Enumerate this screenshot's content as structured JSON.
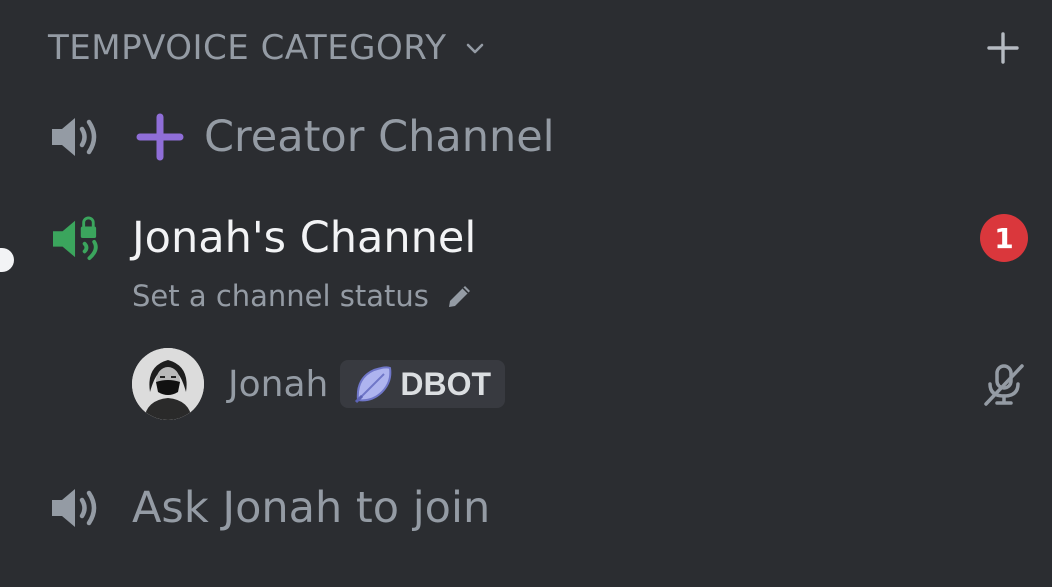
{
  "category": {
    "title": "TEMPVOICE CATEGORY",
    "chevron_icon": "chevron-down-icon",
    "add_icon": "plus-icon"
  },
  "channels": [
    {
      "name": "Creator Channel",
      "icon": "speaker-icon",
      "prefix_icon": "plus-icon",
      "prefix_color": "#8f6ed8"
    },
    {
      "name": "Jonah's Channel",
      "icon": "speaker-lock-icon",
      "icon_color": "#3ba55d",
      "status_placeholder": "Set a channel status",
      "status_icon": "pencil-icon",
      "mention_count": "1",
      "badge_color": "#da373c",
      "members": [
        {
          "name": "Jonah",
          "guild_tag": "DBOT",
          "guild_tag_icon": "leaf-icon",
          "voice_state_icon": "mic-muted-icon"
        }
      ]
    },
    {
      "name": "Ask Jonah to join",
      "icon": "speaker-icon"
    }
  ],
  "colors": {
    "background": "#2b2d31",
    "muted_text": "#949ba4",
    "active_text": "#f2f3f5"
  }
}
